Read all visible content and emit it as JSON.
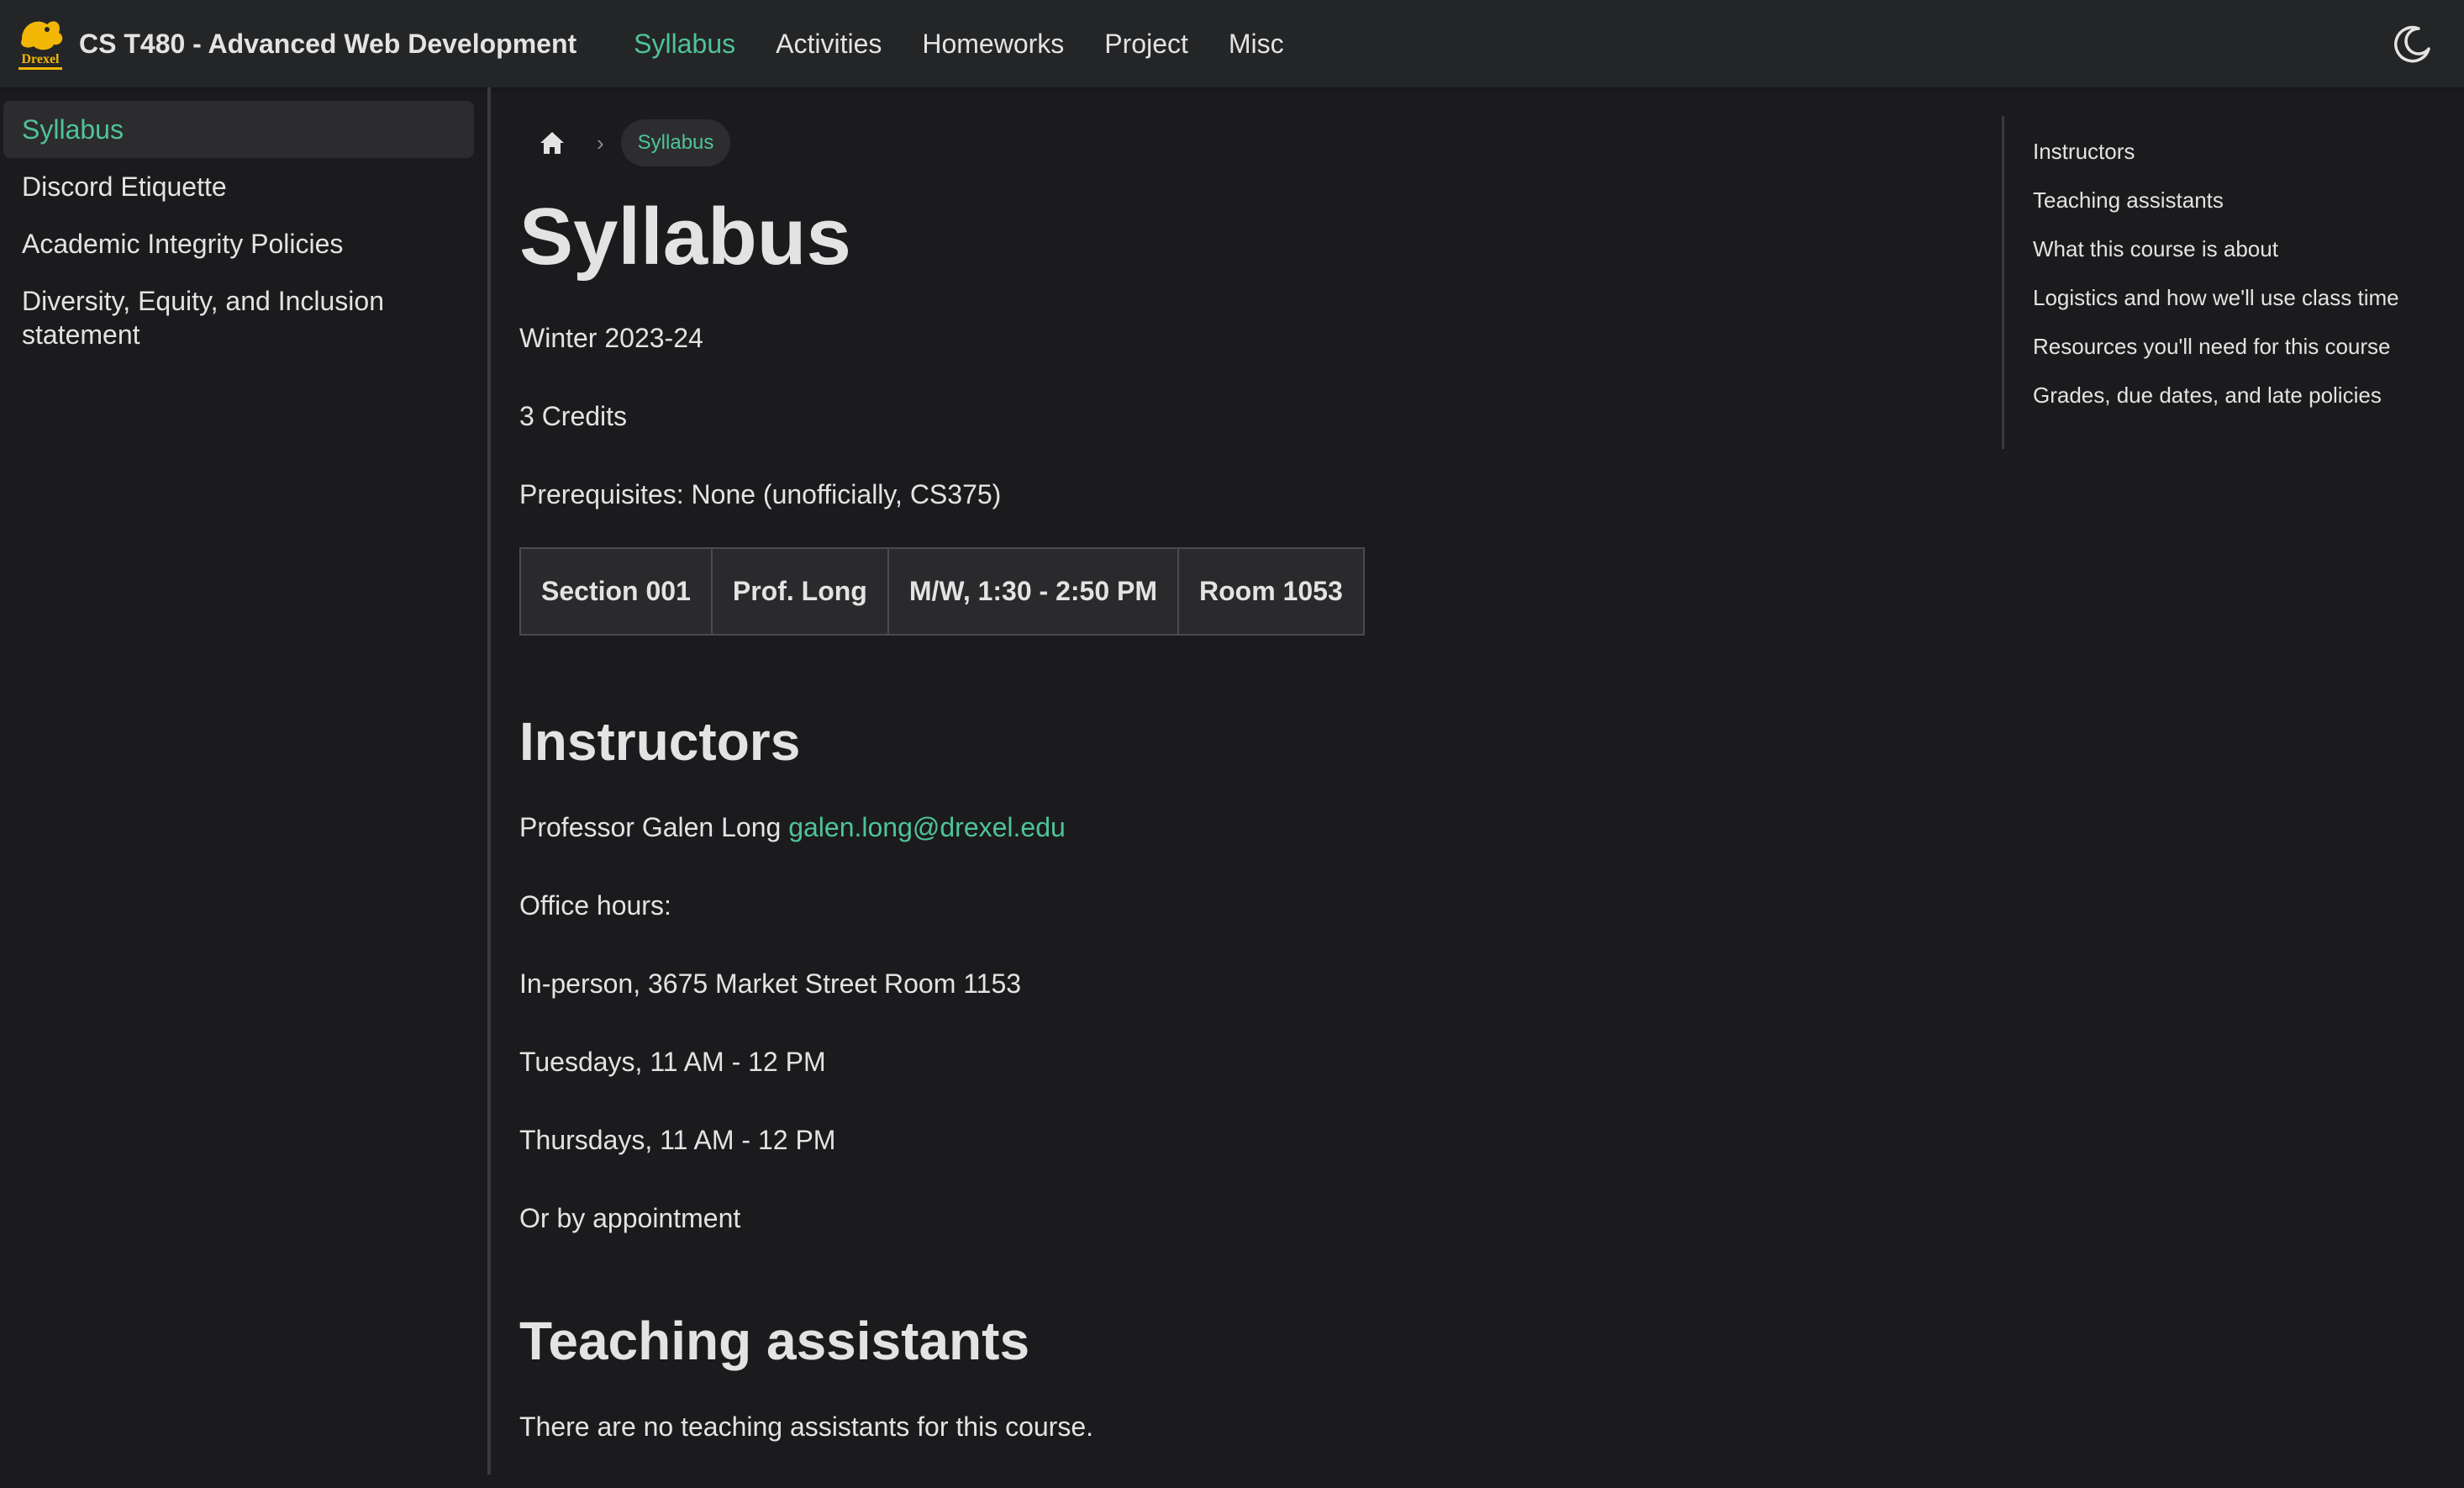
{
  "navbar": {
    "title": "CS T480 - Advanced Web Development",
    "links": [
      {
        "label": "Syllabus",
        "active": true
      },
      {
        "label": "Activities"
      },
      {
        "label": "Homeworks"
      },
      {
        "label": "Project"
      },
      {
        "label": "Misc"
      }
    ],
    "accent_color": "#4fc39a",
    "theme_toggle_icon": "moon-icon"
  },
  "sidebar": {
    "items": [
      {
        "label": "Syllabus",
        "active": true
      },
      {
        "label": "Discord Etiquette"
      },
      {
        "label": "Academic Integrity Policies"
      },
      {
        "label": "Diversity, Equity, and Inclusion statement"
      }
    ]
  },
  "breadcrumb": {
    "home_icon": "home-icon",
    "current": "Syllabus"
  },
  "main": {
    "title": "Syllabus",
    "term": "Winter 2023-24",
    "credits": "3 Credits",
    "prereqs": "Prerequisites: None (unofficially, CS375)",
    "sections_table": [
      [
        "Section 001",
        "Prof. Long",
        "M/W, 1:30 - 2:50 PM",
        "Room 1053"
      ]
    ],
    "instructors": {
      "heading": "Instructors",
      "name": "Professor Galen Long",
      "email": "galen.long@drexel.edu",
      "office_hours_label": "Office hours:",
      "location": "In-person, 3675 Market Street Room 1153",
      "hours_1": "Tuesdays, 11 AM - 12 PM",
      "hours_2": "Thursdays, 11 AM - 12 PM",
      "hours_3": "Or by appointment"
    },
    "tas": {
      "heading": "Teaching assistants",
      "text": "There are no teaching assistants for this course."
    }
  },
  "toc": {
    "items": [
      "Instructors",
      "Teaching assistants",
      "What this course is about",
      "Logistics and how we'll use class time",
      "Resources you'll need for this course",
      "Grades, due dates, and late policies"
    ]
  }
}
